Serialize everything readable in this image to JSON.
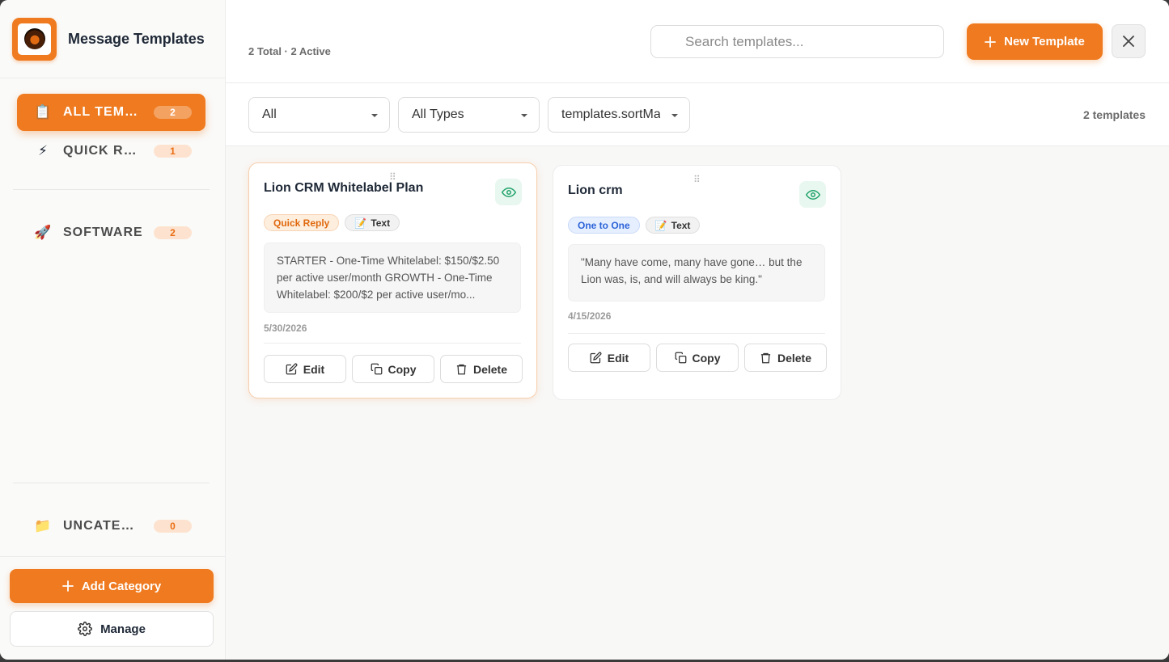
{
  "app": {
    "title": "Message Templates"
  },
  "sidebar": {
    "categories": [
      {
        "emoji": "📋",
        "label": "ALL TEMPLATES",
        "count": "2",
        "active": true
      },
      {
        "emoji": "⚡",
        "label": "QUICK REPLIES",
        "count": "1",
        "active": false
      },
      {
        "emoji": "🚀",
        "label": "SOFTWARE",
        "count": "2",
        "active": false
      },
      {
        "emoji": "📁",
        "label": "UNCATEGORIZED",
        "count": "0",
        "active": false
      }
    ],
    "add_category_label": "Add Category",
    "manage_label": "Manage"
  },
  "header": {
    "stats": "2 Total · 2 Active",
    "search_placeholder": "Search templates...",
    "new_template_label": "New Template"
  },
  "filters": {
    "status": "All",
    "type": "All Types",
    "sort": "templates.sortManual",
    "count_label": "2 templates"
  },
  "templates": [
    {
      "title": "Lion CRM Whitelabel Plan",
      "category_tag": "Quick Reply",
      "type_tag": "Text",
      "type_emoji": "📝",
      "preview": "STARTER - One-Time Whitelabel: $150/$2.50 per active user/month GROWTH - One-Time Whitelabel: $200/$2 per active user/mo...",
      "date": "5/30/2026"
    },
    {
      "title": "Lion crm",
      "category_tag": "One to One",
      "type_tag": "Text",
      "type_emoji": "📝",
      "preview": "\"Many have come, many have gone… but the Lion was, is, and will always be king.\"",
      "date": "4/15/2026"
    }
  ],
  "card_actions": {
    "edit": "Edit",
    "copy": "Copy",
    "delete": "Delete"
  },
  "colors": {
    "accent": "#ef7a1f",
    "eye_icon": "#22a36b",
    "one_to_one": "#2c64d8"
  }
}
